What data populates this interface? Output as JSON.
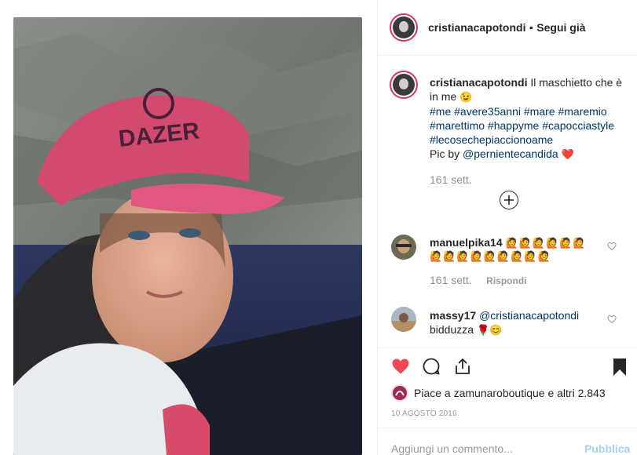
{
  "header": {
    "username": "cristianacapotondi",
    "separator": "•",
    "follow_state": "Segui già"
  },
  "caption": {
    "username": "cristianacapotondi",
    "text": "Il maschietto che è in me",
    "emoji": "😉",
    "hashtags_line1": [
      "#me",
      "#avere35anni",
      "#mare",
      "#maremio"
    ],
    "hashtags_line2": [
      "#marettimo",
      "#happyme",
      "#capocciastyle"
    ],
    "hashtags_line3": [
      "#lecosechepiaccionoame"
    ],
    "credit_prefix": "Pic by",
    "credit_user": "@pernientecandida",
    "credit_emoji": "❤️",
    "time": "161 sett."
  },
  "load_more_icon": "plus-circle-icon",
  "comments": [
    {
      "username": "manuelpika14",
      "emoji_row1": "🙋🙋🙋🙋🙋🙋",
      "emoji_row2": "🙋🙋🙋🙋🙋🙋🙋🙋🙋",
      "time": "161 sett.",
      "reply_label": "Rispondi"
    },
    {
      "username": "massy17",
      "mention": "@cristianacapotondi",
      "text": "bidduzza",
      "emoji": "🌹😊"
    }
  ],
  "likes": {
    "text": "Piace a zamunaroboutique e altri 2.843"
  },
  "date": "10 AGOSTO 2016",
  "comment_input": {
    "placeholder": "Aggiungi un commento...",
    "post_label": "Pubblica"
  },
  "colors": {
    "like_red": "#ed4956",
    "link_blue": "#003569",
    "publish_blue": "#3897f0"
  }
}
